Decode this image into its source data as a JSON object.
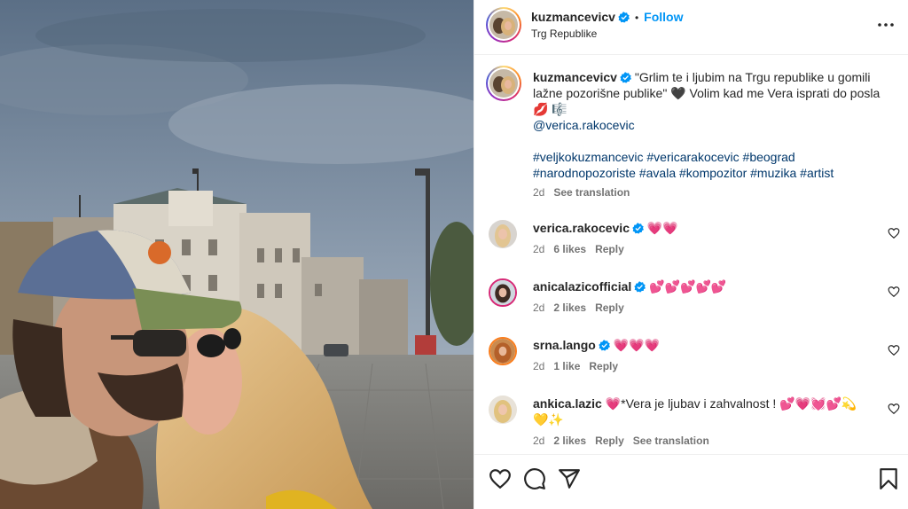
{
  "post": {
    "author": "kuzmancevicv",
    "follow_label": "Follow",
    "location": "Trg Republike",
    "caption_text": "\"Grlim te i ljubim na Trgu republike u gomili lažne pozorišne publike\" 🖤 Volim kad me Vera isprati do posla 💋 🎼",
    "caption_mention": "@verica.rakocevic",
    "hashtags": "#veljkokuzmancevic #vericarakocevic #beograd #narodnopozoriste #avala #kompozitor #muzika #artist",
    "caption_age": "2d",
    "see_translation": "See translation"
  },
  "comments": [
    {
      "user": "verica.rakocevic",
      "text": "💗💗",
      "age": "2d",
      "likes": "6 likes",
      "reply": "Reply",
      "extra": ""
    },
    {
      "user": "anicalazicofficial",
      "text": "💕💕💕💕💕",
      "age": "2d",
      "likes": "2 likes",
      "reply": "Reply",
      "extra": ""
    },
    {
      "user": "srna.lango",
      "text": "💗💗💗",
      "age": "2d",
      "likes": "1 like",
      "reply": "Reply",
      "extra": ""
    },
    {
      "user": "ankica.lazic",
      "text": "💗*Vera je ljubav i zahvalnost ! 💕💗💓💕💫💛✨",
      "age": "2d",
      "likes": "2 likes",
      "reply": "Reply",
      "extra": "See translation"
    }
  ],
  "icons": {
    "verified": "verified-badge-icon",
    "more": "more-options-icon",
    "like": "heart-outline-icon",
    "comment": "comment-icon",
    "share": "share-icon",
    "save": "bookmark-icon"
  },
  "colors": {
    "accent": "#0095f6",
    "verified": "#0095f6",
    "link": "#00376b",
    "muted": "#737373"
  }
}
